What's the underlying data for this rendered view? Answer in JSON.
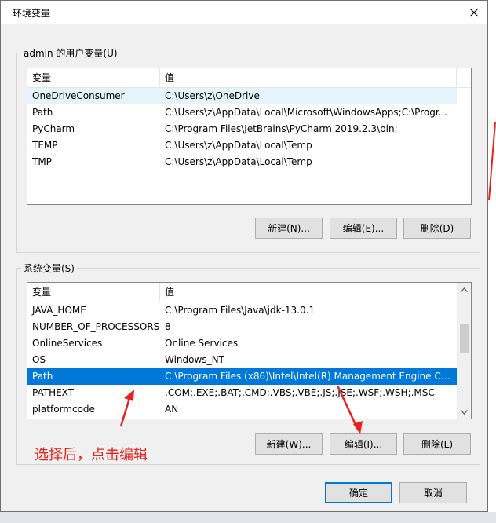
{
  "window": {
    "title": "环境变量"
  },
  "user_vars": {
    "legend": "admin 的用户变量(U)",
    "header": {
      "name": "变量",
      "value": "值"
    },
    "rows": [
      {
        "name": "OneDriveConsumer",
        "value": "C:\\Users\\z\\OneDrive"
      },
      {
        "name": "Path",
        "value": "C:\\Users\\z\\AppData\\Local\\Microsoft\\WindowsApps;C:\\Progr..."
      },
      {
        "name": "PyCharm",
        "value": "C:\\Program Files\\JetBrains\\PyCharm 2019.2.3\\bin;"
      },
      {
        "name": "TEMP",
        "value": "C:\\Users\\z\\AppData\\Local\\Temp"
      },
      {
        "name": "TMP",
        "value": "C:\\Users\\z\\AppData\\Local\\Temp"
      }
    ],
    "buttons": {
      "new": "新建(N)...",
      "edit": "编辑(E)...",
      "delete": "删除(D)"
    }
  },
  "sys_vars": {
    "legend": "系统变量(S)",
    "header": {
      "name": "变量",
      "value": "值"
    },
    "rows": [
      {
        "name": "JAVA_HOME",
        "value": "C:\\Program Files\\Java\\jdk-13.0.1"
      },
      {
        "name": "NUMBER_OF_PROCESSORS",
        "value": "8"
      },
      {
        "name": "OnlineServices",
        "value": "Online Services"
      },
      {
        "name": "OS",
        "value": "Windows_NT"
      },
      {
        "name": "Path",
        "value": "C:\\Program Files (x86)\\Intel\\Intel(R) Management Engine Co..."
      },
      {
        "name": "PATHEXT",
        "value": ".COM;.EXE;.BAT;.CMD;.VBS;.VBE;.JS;.JSE;.WSF;.WSH;.MSC"
      },
      {
        "name": "platformcode",
        "value": "AN"
      }
    ],
    "selected_row": 4,
    "buttons": {
      "new": "新建(W)...",
      "edit": "编辑(I)...",
      "delete": "删除(L)"
    }
  },
  "footer": {
    "ok": "确定",
    "cancel": "取消"
  },
  "annotation": {
    "text": "选择后，点击编辑",
    "color": "#e8211c"
  },
  "colors": {
    "selection": "#0078d7",
    "accent": "#0078d7"
  },
  "icons": {
    "close": "close-icon",
    "scroll_up": "chevron-up-icon",
    "scroll_down": "chevron-down-icon"
  }
}
